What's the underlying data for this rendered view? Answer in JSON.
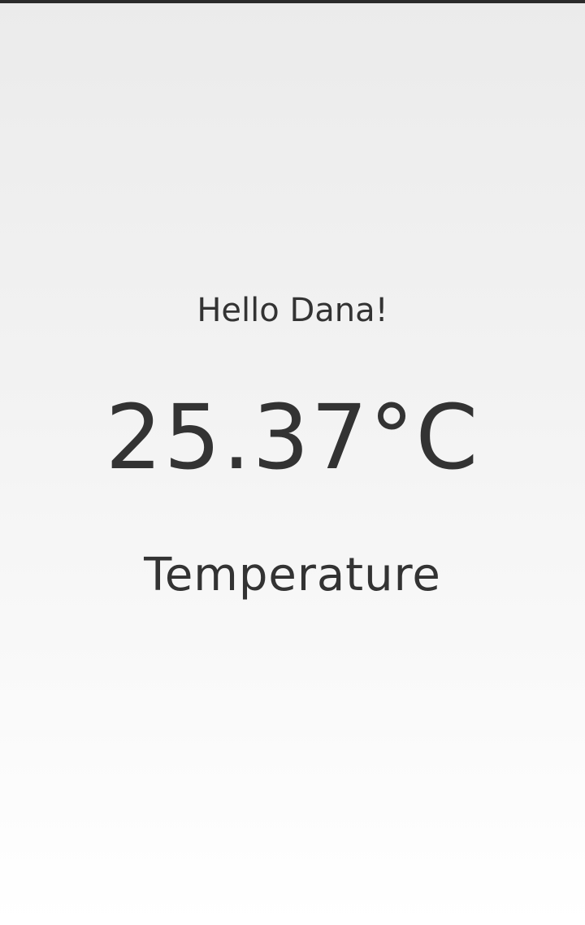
{
  "greeting": "Hello Dana!",
  "temperature": {
    "value": "25.37°C",
    "label": "Temperature"
  },
  "colors": {
    "text": "#333333",
    "top_bar": "#2b2b2b",
    "background_top": "#ebebeb",
    "background_bottom": "#ffffff"
  }
}
